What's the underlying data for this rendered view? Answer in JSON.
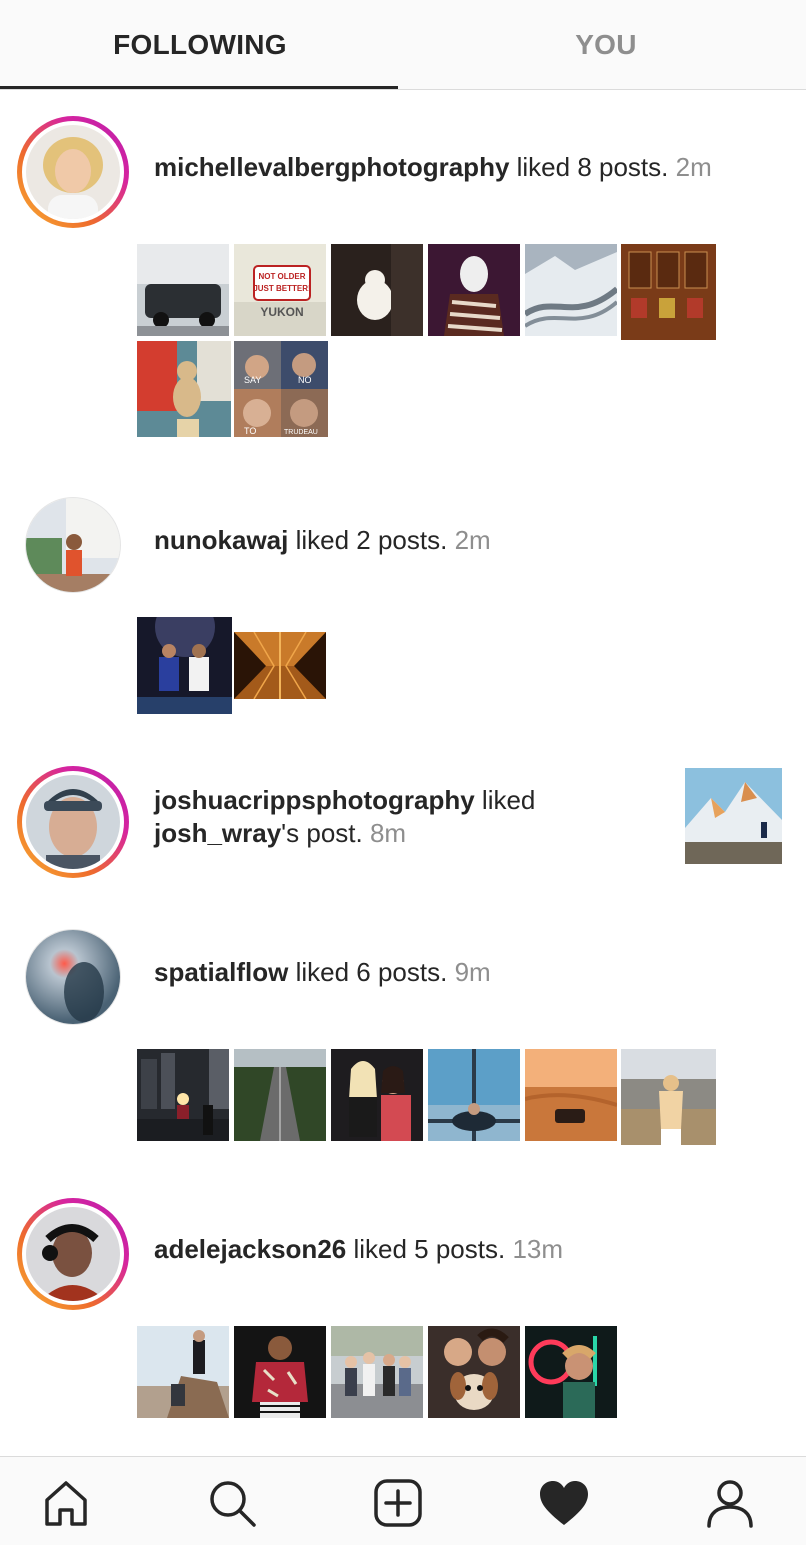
{
  "tabs": {
    "following": "FOLLOWING",
    "you": "YOU",
    "active": "following"
  },
  "activities": [
    {
      "username": "michellevalbergphotography",
      "action": " liked 8 posts.",
      "time": "2m",
      "story_ring": true,
      "thumbs": [
        {
          "kind": "car"
        },
        {
          "kind": "sign",
          "lines": [
            "NOT OLDER",
            "JUST BETTER!"
          ],
          "footer": "YUKON"
        },
        {
          "kind": "figurine"
        },
        {
          "kind": "pet-scarf"
        },
        {
          "kind": "glacier"
        },
        {
          "kind": "wood-panel"
        },
        {
          "kind": "statue"
        },
        {
          "kind": "meme",
          "captions": [
            "SAY",
            "NO",
            "TO",
            "TRUDEAU"
          ]
        }
      ]
    },
    {
      "username": "nunokawaj",
      "action": " liked 2 posts.",
      "time": "2m",
      "story_ring": false,
      "thumbs": [
        {
          "kind": "soccer"
        },
        {
          "kind": "escalator"
        }
      ]
    },
    {
      "username": "joshuacrippsphotography",
      "action": " liked",
      "target_user": "josh_wray",
      "target_suffix": "'s post.",
      "time": "8m",
      "story_ring": true,
      "preview": {
        "kind": "mountain"
      }
    },
    {
      "username": "spatialflow",
      "action": " liked 6 posts.",
      "time": "9m",
      "story_ring": false,
      "thumbs": [
        {
          "kind": "train-city"
        },
        {
          "kind": "forest-road"
        },
        {
          "kind": "party"
        },
        {
          "kind": "window-view"
        },
        {
          "kind": "desert"
        },
        {
          "kind": "hillside"
        }
      ]
    },
    {
      "username": "adelejackson26",
      "action": " liked 5 posts.",
      "time": "13m",
      "story_ring": true,
      "thumbs": [
        {
          "kind": "rock-climber"
        },
        {
          "kind": "jacket-man"
        },
        {
          "kind": "group-bridge"
        },
        {
          "kind": "couple-dog"
        },
        {
          "kind": "neon"
        }
      ]
    }
  ],
  "nav": [
    {
      "icon": "home-icon"
    },
    {
      "icon": "search-icon"
    },
    {
      "icon": "new-post-icon"
    },
    {
      "icon": "activity-heart-icon",
      "active": true
    },
    {
      "icon": "profile-icon"
    }
  ],
  "colors": {
    "story_ring": [
      "#f9b233",
      "#ee6c2c",
      "#d6249f",
      "#b81fae"
    ],
    "muted": "#8e8e8e",
    "text": "#262626"
  }
}
